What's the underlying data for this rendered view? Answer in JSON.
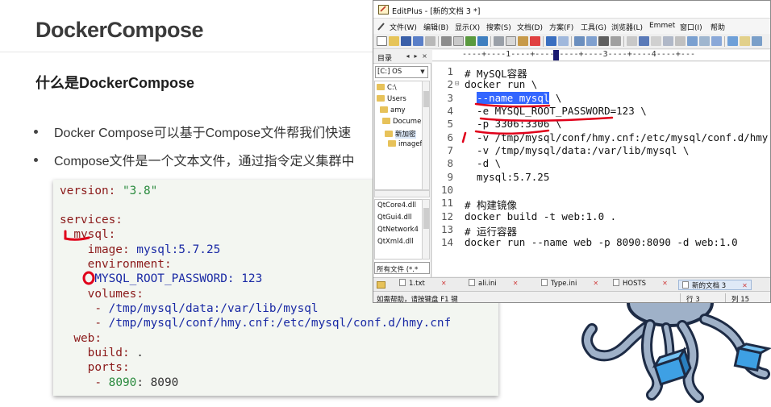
{
  "slide": {
    "title": "DockerCompose",
    "subtitle": "什么是DockerCompose",
    "bullets": [
      "Docker Compose可以基于Compose文件帮我们快速",
      "Compose文件是一个文本文件，通过指令定义集群中"
    ]
  },
  "yaml_code": [
    {
      "key": "version:",
      "value": " \"3.8\""
    },
    {
      "key": "services:"
    },
    {
      "key": "  mysql:"
    },
    {
      "key": "    image:",
      "value": " mysql:5.7.25"
    },
    {
      "key": "    environment:"
    },
    {
      "key": "     MYSQL_ROOT_PASSWORD:",
      "value": " 123"
    },
    {
      "key": "    volumes:"
    },
    {
      "dash": "     - ",
      "value": "/tmp/mysql/data:/var/lib/mysql"
    },
    {
      "dash": "     - ",
      "value": "/tmp/mysql/conf/hmy.cnf:/etc/mysql/conf.d/hmy.cnf"
    },
    {
      "key": "  web:"
    },
    {
      "key": "    build:",
      "value": " ."
    },
    {
      "key": "    ports:"
    },
    {
      "dash": "     - ",
      "value": "8090",
      "rest": ": 8090"
    }
  ],
  "editplus": {
    "title": "EditPlus - [新的文档 3 *]",
    "menu": [
      "文件(W)",
      "编辑(B)",
      "显示(X)",
      "搜索(S)",
      "文档(D)",
      "方案(F)",
      "工具(G)",
      "浏览器(L)",
      "Emmet",
      "窗口(I)",
      "帮助"
    ],
    "left_panel": {
      "header": "目录",
      "drive": "[C:] OS",
      "tree": [
        "C:\\",
        "Users",
        "amy",
        "Document",
        "新加密",
        "imagefor"
      ],
      "files": [
        "QtCore4.dll",
        "QtGui4.dll",
        "QtNetwork4",
        "QtXml4.dll"
      ],
      "filter": "所有文件 (*.*"
    },
    "ruler": "----+----1----+----2----+----3----+----4----+---",
    "lines": [
      {
        "n": "1",
        "text": "# MySQL容器"
      },
      {
        "n": "2",
        "text": "docker run \\",
        "fold": "⊟"
      },
      {
        "n": "3",
        "pre": "  ",
        "sel": "--name mysql",
        "post": " \\"
      },
      {
        "n": "4",
        "text": "  -e MYSQL_ROOT_PASSWORD=123 \\"
      },
      {
        "n": "5",
        "text": "  -p 3306:3306 \\"
      },
      {
        "n": "6",
        "text": "  -v /tmp/mysql/conf/hmy.cnf:/etc/mysql/conf.d/hmy"
      },
      {
        "n": "7",
        "text": "  -v /tmp/mysql/data:/var/lib/mysql \\"
      },
      {
        "n": "8",
        "text": "  -d \\"
      },
      {
        "n": "9",
        "text": "  mysql:5.7.25"
      },
      {
        "n": "10",
        "text": ""
      },
      {
        "n": "11",
        "text": "# 构建镜像"
      },
      {
        "n": "12",
        "text": "docker build -t web:1.0 ."
      },
      {
        "n": "13",
        "text": "# 运行容器"
      },
      {
        "n": "14",
        "text": "docker run --name web -p 8090:8090 -d web:1.0"
      }
    ],
    "tabs": [
      "1.txt",
      "ali.ini",
      "Type.ini",
      "HOSTS",
      "新的文档 3"
    ],
    "status": {
      "help": "如需帮助，请按键盘 F1 键",
      "line": "行 3",
      "col": "列 15"
    }
  },
  "colors": {
    "yaml_key": "#8b1a1a",
    "yaml_string": "#2a8a3e",
    "yaml_value": "#1a2aa5",
    "selection": "#3366ff",
    "annotation_red": "#e0001a"
  }
}
